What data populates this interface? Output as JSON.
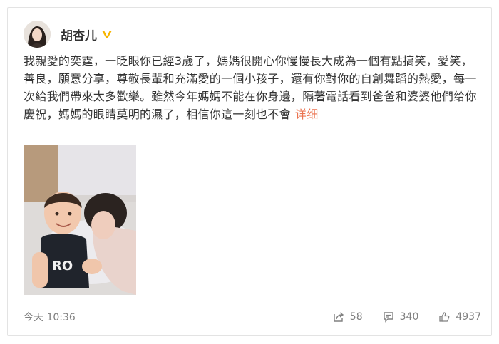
{
  "post": {
    "author": "胡杏儿",
    "body": "我親愛的奕霆，一眨眼你已經3歲了，媽媽很開心你慢慢長大成為一個有點搞笑，愛笑，善良，願意分享，尊敬長輩和充滿愛的一個小孩子，還有你對你的自創舞蹈的熱愛，每一次給我們帶來太多歡樂。雖然今年媽媽不能在你身邊，隔著電話看到爸爸和婆婆他們给你慶祝，媽媽的眼睛莫明的濕了，相信你這一刻也不會",
    "more_label": "详细",
    "timestamp": "今天 10:36",
    "actions": {
      "share_count": "58",
      "comment_count": "340",
      "like_count": "4937"
    }
  },
  "icons": {
    "verified": "verified-v-icon",
    "share": "share-icon",
    "comment": "comment-icon",
    "like": "thumbs-up-icon"
  },
  "colors": {
    "link": "#eb7350",
    "verified": "#f7b500",
    "meta": "#808080"
  }
}
